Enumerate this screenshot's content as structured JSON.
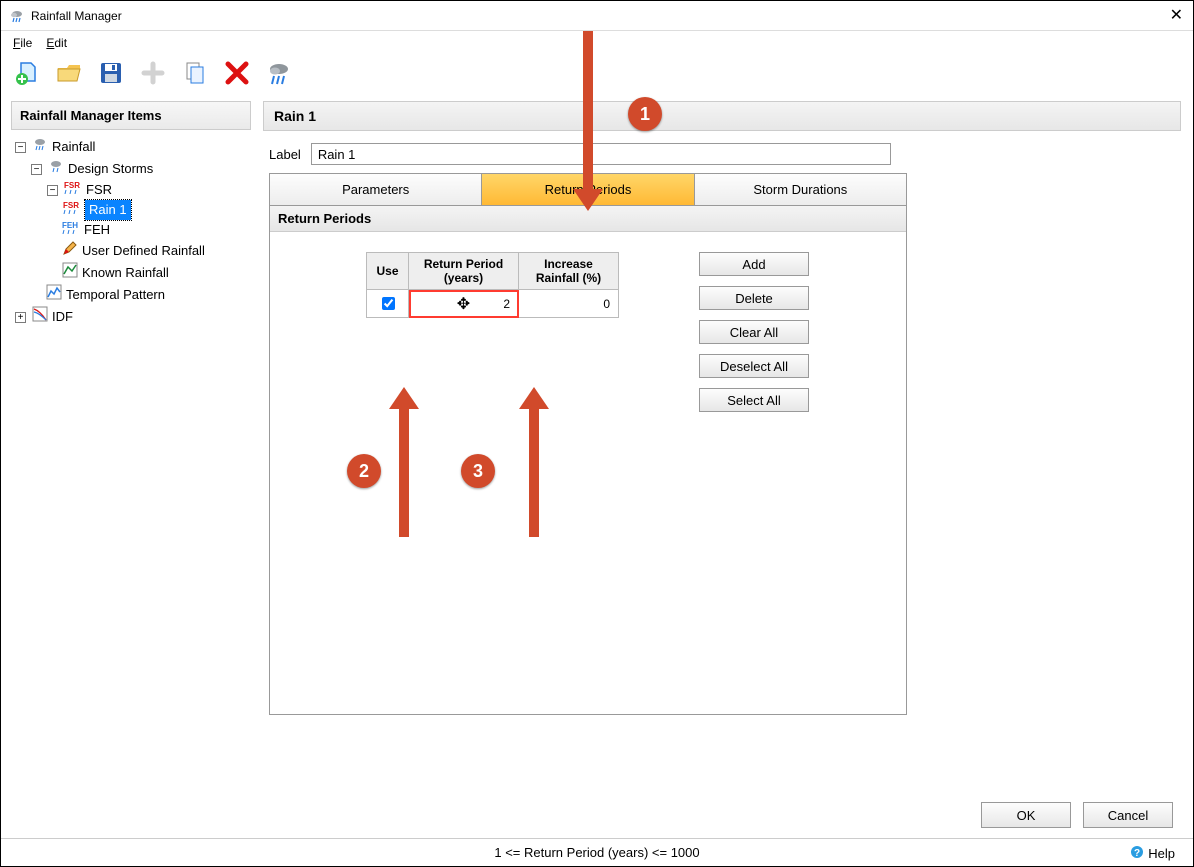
{
  "window": {
    "title": "Rainfall Manager"
  },
  "menu": {
    "file": "File",
    "edit": "Edit"
  },
  "sidebar": {
    "title": "Rainfall Manager Items",
    "root": "Rainfall",
    "design_storms": "Design Storms",
    "fsr": "FSR",
    "rain1": "Rain 1",
    "feh": "FEH",
    "user_defined": "User Defined Rainfall",
    "known": "Known Rainfall",
    "temporal": "Temporal Pattern",
    "idf": "IDF"
  },
  "editor": {
    "title": "Rain 1",
    "label_text": "Label",
    "label_value": "Rain 1"
  },
  "tabs": {
    "params": "Parameters",
    "return_periods": "Return Periods",
    "storm_durations": "Storm Durations"
  },
  "panel": {
    "heading": "Return Periods",
    "headers": {
      "use": "Use",
      "return_period": "Return Period (years)",
      "increase": "Increase Rainfall (%)"
    },
    "row": {
      "use_checked": true,
      "return_period": "2",
      "increase": "0"
    },
    "buttons": {
      "add": "Add",
      "delete": "Delete",
      "clear_all": "Clear All",
      "deselect_all": "Deselect All",
      "select_all": "Select All"
    }
  },
  "dialog_buttons": {
    "ok": "OK",
    "cancel": "Cancel"
  },
  "status": "1 <= Return Period (years) <= 1000",
  "help": "Help",
  "callouts": {
    "c1": "1",
    "c2": "2",
    "c3": "3"
  }
}
